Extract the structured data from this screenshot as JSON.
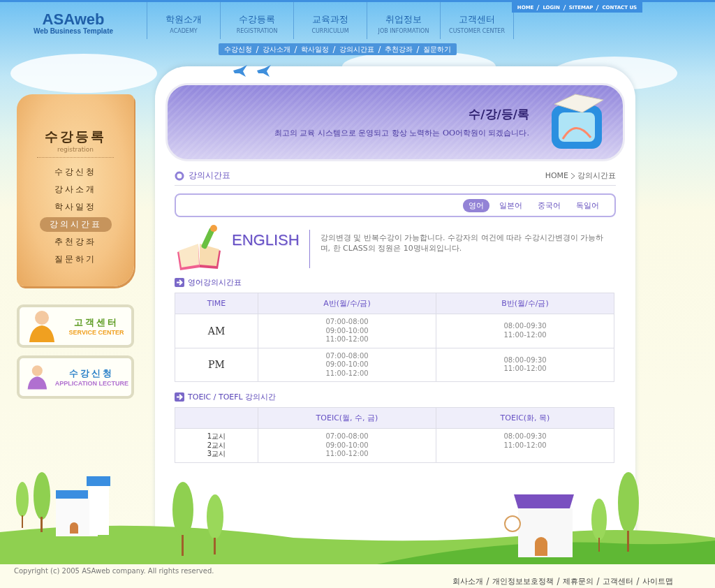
{
  "header": {
    "logo": {
      "title": "ASAweb",
      "subtitle": "Web Business Template"
    },
    "nav": [
      {
        "label": "학원소개",
        "sub": "ACADEMY"
      },
      {
        "label": "수강등록",
        "sub": "REGISTRATION"
      },
      {
        "label": "교육과정",
        "sub": "CURRICULUM"
      },
      {
        "label": "취업정보",
        "sub": "JOB INFORMATION"
      },
      {
        "label": "고객센터",
        "sub": "CUSTOMER CENTER"
      }
    ],
    "utility_links": [
      "HOME",
      "LOGIN",
      "SITEMAP",
      "CONTACT US"
    ],
    "subnav": [
      "수강신청",
      "강사소개",
      "학사일정",
      "강의시간표",
      "추천강좌",
      "질문하기"
    ]
  },
  "sidebar": {
    "title": "수강등록",
    "subtitle": "registration",
    "items": [
      {
        "label": "수강신청",
        "selected": false
      },
      {
        "label": "강사소개",
        "selected": false
      },
      {
        "label": "학사일정",
        "selected": false
      },
      {
        "label": "강의시간표",
        "selected": true
      },
      {
        "label": "추천강좌",
        "selected": false
      },
      {
        "label": "질문하기",
        "selected": false
      }
    ],
    "banners": [
      {
        "title": {
          "text": "고객센터",
          "color": "#5a9a20"
        },
        "subtitle": {
          "text": "SERVICE CENTER",
          "color": "#f0a020"
        }
      },
      {
        "title": {
          "text": "수강신청",
          "color": "#2a80c8"
        },
        "subtitle": {
          "text": "APPLICATION LECTURE",
          "color": "#b070d0"
        }
      }
    ]
  },
  "banner": {
    "title": "수/강/등/록",
    "text": "최고의 교육 시스템으로 운영되고 항상 노력하는 OO어학원이 되겠습니다."
  },
  "page_title": "강의시간표",
  "breadcrumb": [
    "HOME",
    "강의시간표"
  ],
  "language_tabs": [
    {
      "label": "영어",
      "selected": true
    },
    {
      "label": "일본어",
      "selected": false
    },
    {
      "label": "중국어",
      "selected": false
    },
    {
      "label": "독일어",
      "selected": false
    }
  ],
  "intro": {
    "heading": "ENGLISH",
    "text": "강의변경 및 반복수강이 가능합니다. 수강자의 여건에 따라 수강시간변경이 가능하며, 한 CLASS의 정원은 10명내외입니다."
  },
  "tables": [
    {
      "title": "영어강의시간표",
      "kind": "time",
      "columns": [
        "TIME",
        "A반(월/수/금)",
        "B반(월/수/금)"
      ],
      "rows": [
        {
          "cells": [
            [
              "AM"
            ],
            [
              "07:00-08:00",
              "09:00-10:00",
              "11:00-12:00"
            ],
            [
              "08:00-09:30",
              "11:00-12:00"
            ]
          ]
        },
        {
          "cells": [
            [
              "PM"
            ],
            [
              "07:00-08:00",
              "09:00-10:00",
              "11:00-12:00"
            ],
            [
              "08:00-09:30",
              "11:00-12:00"
            ]
          ]
        }
      ]
    },
    {
      "title": "TOEIC / TOEFL 강의시간",
      "kind": "period",
      "columns": [
        "",
        "TOEIC(월, 수, 금)",
        "TOEIC(화, 목)"
      ],
      "rows": [
        {
          "cells": [
            [
              "1교시",
              "2교시",
              "3교시"
            ],
            [
              "07:00-08:00",
              "09:00-10:00",
              "11:00-12:00"
            ],
            [
              "08:00-09:30",
              "11:00-12:00"
            ]
          ]
        }
      ]
    }
  ],
  "footer": {
    "copyright": "Copyright (c) 2005 ASAweb company. All rights reserved.",
    "links": [
      "회사소개",
      "개인정보보호정책",
      "제휴문의",
      "고객센터",
      "사이트맵"
    ]
  }
}
